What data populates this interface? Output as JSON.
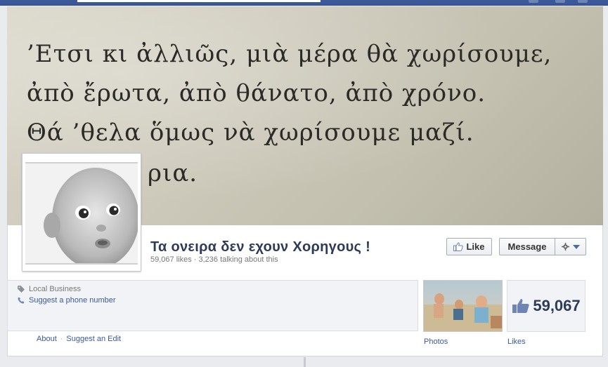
{
  "cover": {
    "lines": [
      "’Ετσι κι ἀλλιῶς, μιὰ μέρα θὰ χωρίσουμε,",
      "ἀπὸ ἔρωτα, ἀπὸ θάνατο, ἀπὸ χρόνο.",
      "Θά ’θελα ὅμως νὰ χωρίσουμε μαζί.",
      "ρια."
    ]
  },
  "page": {
    "name": "Τα ονειρα δεν εχουν Χορηγους !",
    "stats": "59,067 likes · 3,236 talking about this"
  },
  "actions": {
    "like_label": "Like",
    "message_label": "Message"
  },
  "info": {
    "category": "Local Business",
    "phone_link": "Suggest a phone number"
  },
  "links": {
    "about": "About",
    "separator": "·",
    "suggest_edit": "Suggest an Edit"
  },
  "apps": {
    "photos_label": "Photos",
    "likes_count": "59,067",
    "likes_label": "Likes"
  },
  "icons": {
    "tag": "tag-icon",
    "phone": "phone-icon",
    "thumb": "thumbs-up-icon",
    "gear": "gear-icon"
  },
  "colors": {
    "brand": "#3b5998",
    "title": "#2d3a5a"
  }
}
